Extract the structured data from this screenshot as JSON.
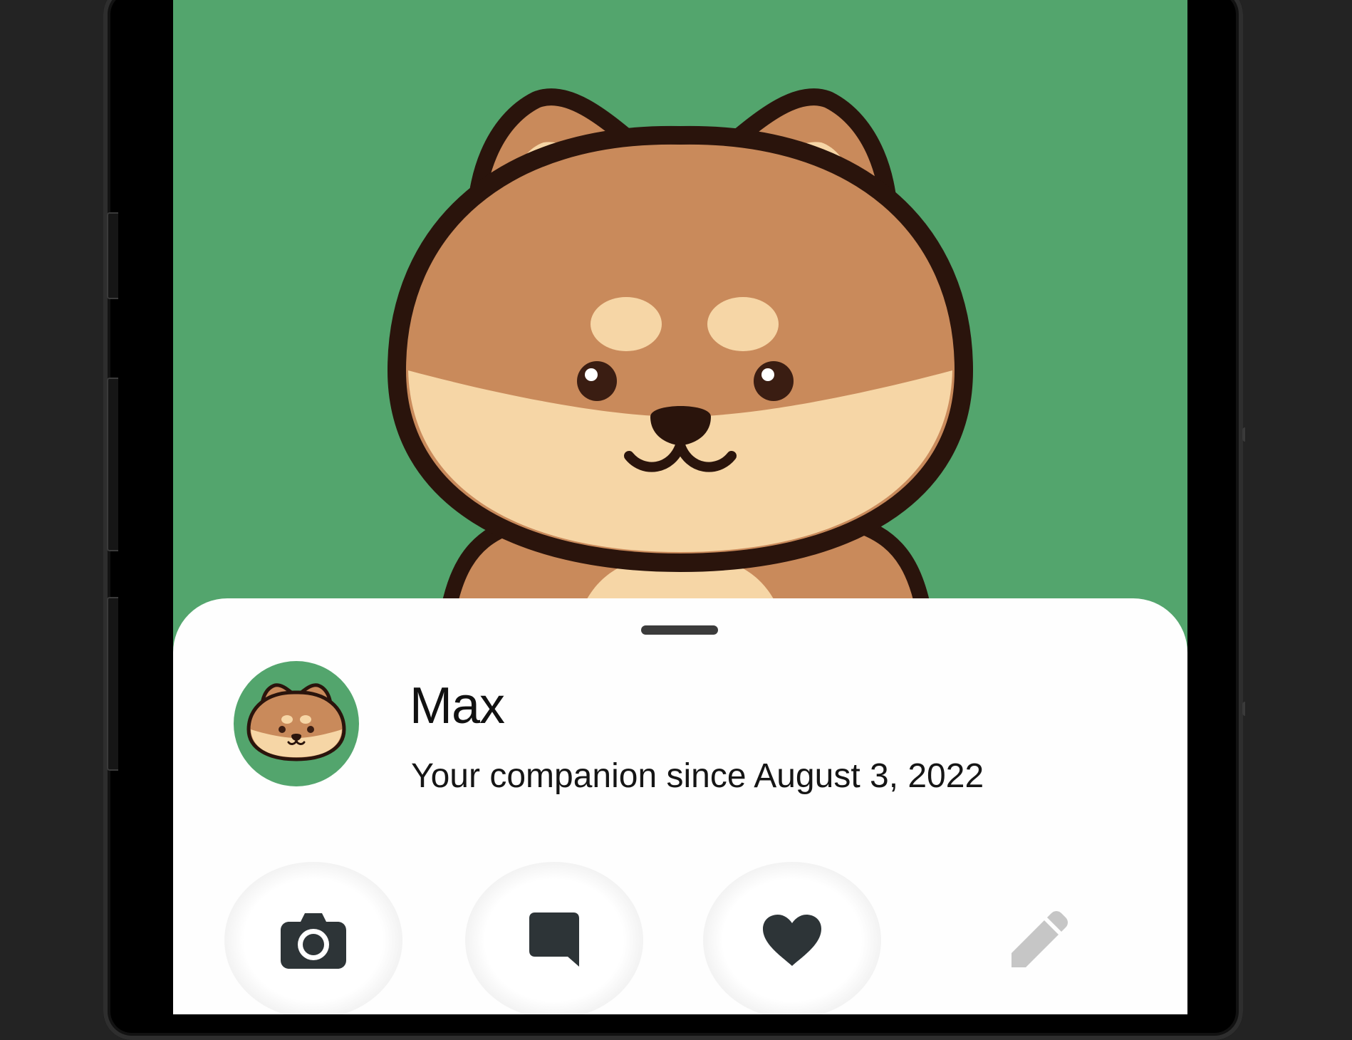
{
  "pet": {
    "name": "Max",
    "subtitle": "Your companion since August 3, 2022"
  },
  "actions": [
    {
      "id": "camera",
      "icon": "camera-icon",
      "enabled": true
    },
    {
      "id": "message",
      "icon": "message-bubble-icon",
      "enabled": true
    },
    {
      "id": "favorite",
      "icon": "heart-icon",
      "enabled": true
    },
    {
      "id": "edit",
      "icon": "pencil-icon",
      "enabled": false
    }
  ],
  "colors": {
    "background": "#53a56d",
    "sheet": "#fefefe",
    "fur": "#c98a5b",
    "fur_light": "#f6d6a6",
    "outline": "#2a140c",
    "icon": "#2d3437",
    "icon_disabled": "#c6c6c6"
  }
}
